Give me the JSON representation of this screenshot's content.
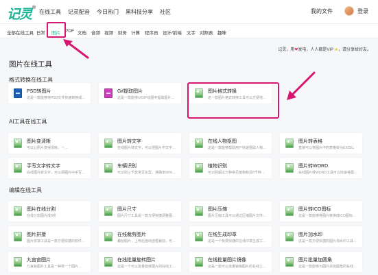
{
  "nav": {
    "logo": "记灵",
    "logo_mark": "®",
    "links": [
      "在线工具",
      "记灵配音",
      "今日热门",
      "黑科技分享",
      "社区"
    ],
    "my_files": "我的文件",
    "login": "登录"
  },
  "categories": {
    "items": [
      "全部在线工具",
      "日常",
      "图片",
      "PDF",
      "文档",
      "音频",
      "视频",
      "财务",
      "计算",
      "程序员",
      "设计/前端",
      "文字",
      "对照表",
      "趣味"
    ],
    "active_index": 2
  },
  "vip_note": {
    "prefix": "记灵，用",
    "heart": "❤",
    "middle": "发电，人人都是VIP",
    "star": "★",
    "suffix": "，请分享给好友。"
  },
  "page_title": "图片在线工具",
  "sections": [
    {
      "title": "格式转换在线工具",
      "cards": [
        {
          "name": "PSD转图片",
          "desc": "这是一款能够将PSD文件快速转换成…",
          "icon": "psd-file-icon"
        },
        {
          "name": "Gif提取图片",
          "desc": "这是一款能够从GIF动图中提取图片的…",
          "icon": "gif-file-icon"
        },
        {
          "name": "图片格式转换",
          "desc": "这一款图片格式转换工具可以方便地…",
          "icon": "image-file-icon"
        }
      ]
    },
    {
      "title": "AI工具在线工具",
      "cards": [
        {
          "name": "图片变清晰",
          "desc": "可以让照片变得清晰，一…",
          "icon": "image-file-icon"
        },
        {
          "name": "图片转文字",
          "desc": "在线图片转文字，可以把图片中文字…",
          "icon": "image-file-icon"
        },
        {
          "name": "在线人物抠图",
          "desc": "这是一款能够帮助用户快速抠取人物…",
          "icon": "image-file-icon"
        },
        {
          "name": "图片转表格",
          "desc": "直接可以将图片中的表格转为EXCEL",
          "icon": "image-file-icon"
        },
        {
          "name": "手写文字转文字",
          "desc": "在线图片转文字，可以把图片中手写…",
          "icon": "image-file-icon"
        },
        {
          "name": "车辆识别",
          "desc": "可识别三千款常见车型，准确率90%…",
          "icon": "image-file-icon"
        },
        {
          "name": "植物识别",
          "desc": "可识别超过万种常见植物和近8千种…",
          "icon": "image-file-icon"
        },
        {
          "name": "图片转WORD",
          "desc": "在线图片转WORD工具可以快速将图…",
          "icon": "image-file-icon"
        }
      ]
    },
    {
      "title": "编辑在线工具",
      "cards": [
        {
          "name": "图片在线分割",
          "desc": "在线分割图片成9份",
          "icon": "image-file-icon"
        },
        {
          "name": "图片尺寸",
          "desc": "图片尺寸工具是一款方便快捷调整图…",
          "icon": "image-file-icon"
        },
        {
          "name": "图片压缩",
          "desc": "图片压缩工具可以通过压缩图片文件…",
          "icon": "image-file-icon"
        },
        {
          "name": "图片转ICO图标",
          "desc": "这是一款能够将图片转换成ICO图标…",
          "icon": "image-file-icon"
        },
        {
          "name": "图片拼接",
          "desc": "图片拼接工具是一款方便快捷的软件…",
          "icon": "image-file-icon"
        },
        {
          "name": "在线裁剪图片",
          "desc": "裁剪图片，上传后拖动选框裁剪，可…",
          "icon": "image-file-icon"
        },
        {
          "name": "在线生成印章",
          "desc": "这是一个免费快捷的在线印章生成工…",
          "icon": "image-file-icon"
        },
        {
          "name": "图片加水印",
          "desc": "这是一款方便快捷的图片加水印工具…",
          "icon": "image-file-icon"
        },
        {
          "name": "九宫宫图片",
          "desc": "九宫宫图片工具是一种将一个图片…",
          "icon": "image-file-icon"
        },
        {
          "name": "在线批量旋转图片",
          "desc": "这是一个可以批量旋转图片的在线工…",
          "icon": "image-file-icon"
        },
        {
          "name": "在线批量图片镜像",
          "desc": "这是一款可以批量镜像图片的在线工…",
          "icon": "image-file-icon"
        },
        {
          "name": "图片批量加圆角",
          "desc": "这是一款能够为图片添加圆角的在线…",
          "icon": "image-file-icon"
        }
      ]
    }
  ],
  "colors": {
    "brand": "#1ab394",
    "annotation": "#d6166f",
    "page_bg": "#f6f7f9"
  }
}
